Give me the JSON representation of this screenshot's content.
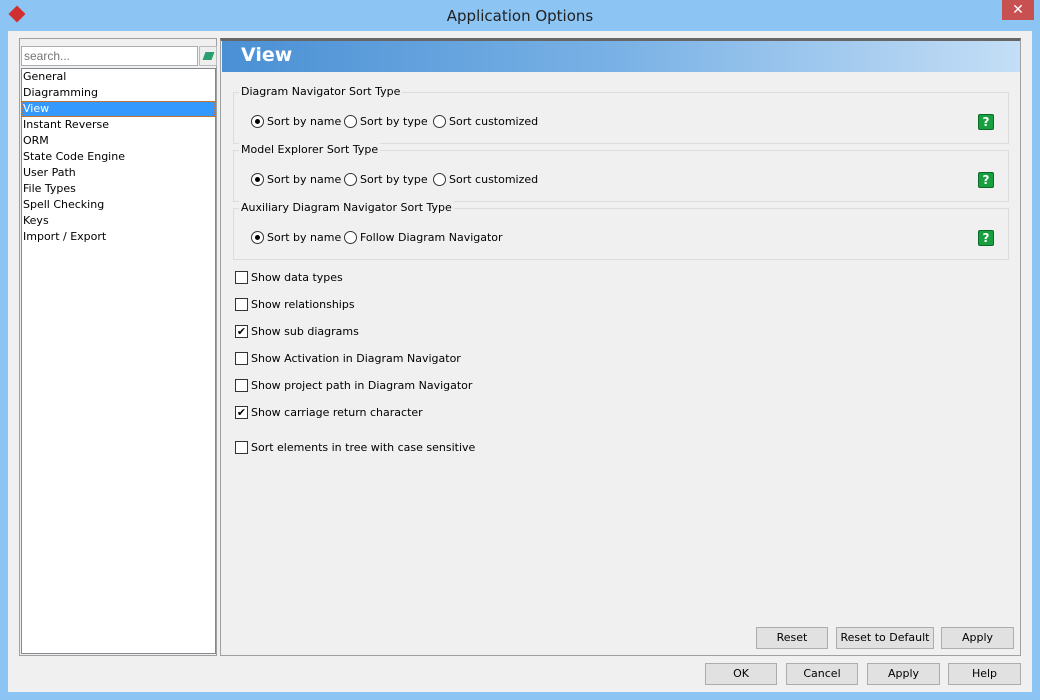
{
  "window": {
    "title": "Application Options",
    "close": "✕"
  },
  "sidebar": {
    "search_placeholder": "search...",
    "items": [
      {
        "label": "General"
      },
      {
        "label": "Diagramming"
      },
      {
        "label": "View",
        "selected": true
      },
      {
        "label": "Instant Reverse"
      },
      {
        "label": "ORM"
      },
      {
        "label": "State Code Engine"
      },
      {
        "label": "User Path"
      },
      {
        "label": "File Types"
      },
      {
        "label": "Spell Checking"
      },
      {
        "label": "Keys"
      },
      {
        "label": "Import / Export"
      }
    ]
  },
  "main": {
    "title": "View",
    "groups": [
      {
        "label": "Diagram Navigator Sort Type",
        "options": [
          "Sort by name",
          "Sort by type",
          "Sort customized"
        ],
        "selected": 0
      },
      {
        "label": "Model Explorer Sort Type",
        "options": [
          "Sort by name",
          "Sort by type",
          "Sort customized"
        ],
        "selected": 0
      },
      {
        "label": "Auxiliary Diagram Navigator Sort Type",
        "options": [
          "Sort by name",
          "Follow Diagram Navigator"
        ],
        "selected": 0
      }
    ],
    "help": "?",
    "checkboxes": [
      {
        "label": "Show data types",
        "checked": false
      },
      {
        "label": "Show relationships",
        "checked": false
      },
      {
        "label": "Show sub diagrams",
        "checked": true
      },
      {
        "label": "Show Activation in Diagram Navigator",
        "checked": false
      },
      {
        "label": "Show project path in Diagram Navigator",
        "checked": false
      },
      {
        "label": "Show carriage return character",
        "checked": true
      },
      {
        "label": "Sort elements in tree with case sensitive",
        "checked": false
      }
    ],
    "buttons": {
      "reset": "Reset",
      "reset_default": "Reset to Default",
      "apply": "Apply"
    }
  },
  "footer": {
    "ok": "OK",
    "cancel": "Cancel",
    "apply": "Apply",
    "help": "Help"
  }
}
